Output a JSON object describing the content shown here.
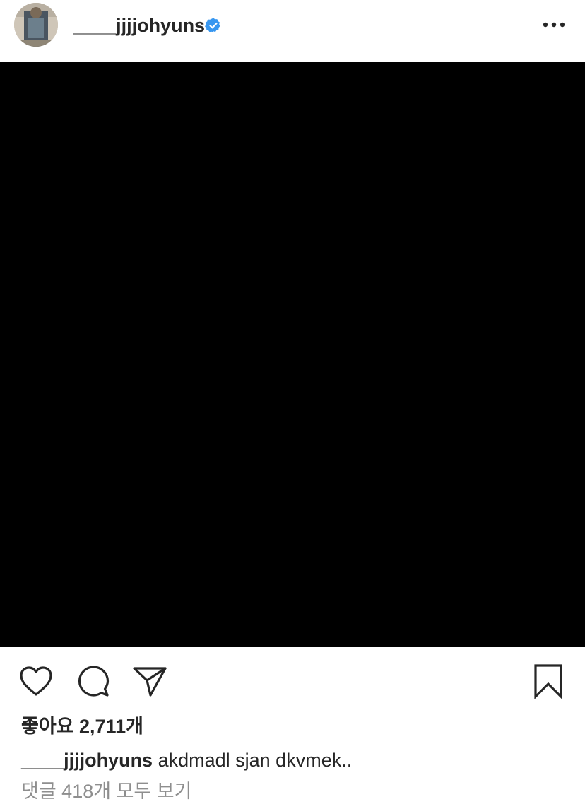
{
  "header": {
    "username": "____jjjjohyuns",
    "verified_icon": "verified-badge-icon",
    "more_icon": "more-options-icon"
  },
  "post": {
    "media_description_color": "#000000"
  },
  "actions": {
    "like_icon": "heart-icon",
    "comment_icon": "comment-icon",
    "share_icon": "send-icon",
    "save_icon": "bookmark-icon"
  },
  "likes": {
    "text": "좋아요 2,711개"
  },
  "caption": {
    "username": "____jjjjohyuns",
    "text": "akdmadl sjan dkvmek.."
  },
  "comments": {
    "view_all": "댓글 418개 모두 보기"
  },
  "colors": {
    "text": "#262626",
    "muted": "#8e8e8e",
    "verified": "#3897f0"
  }
}
